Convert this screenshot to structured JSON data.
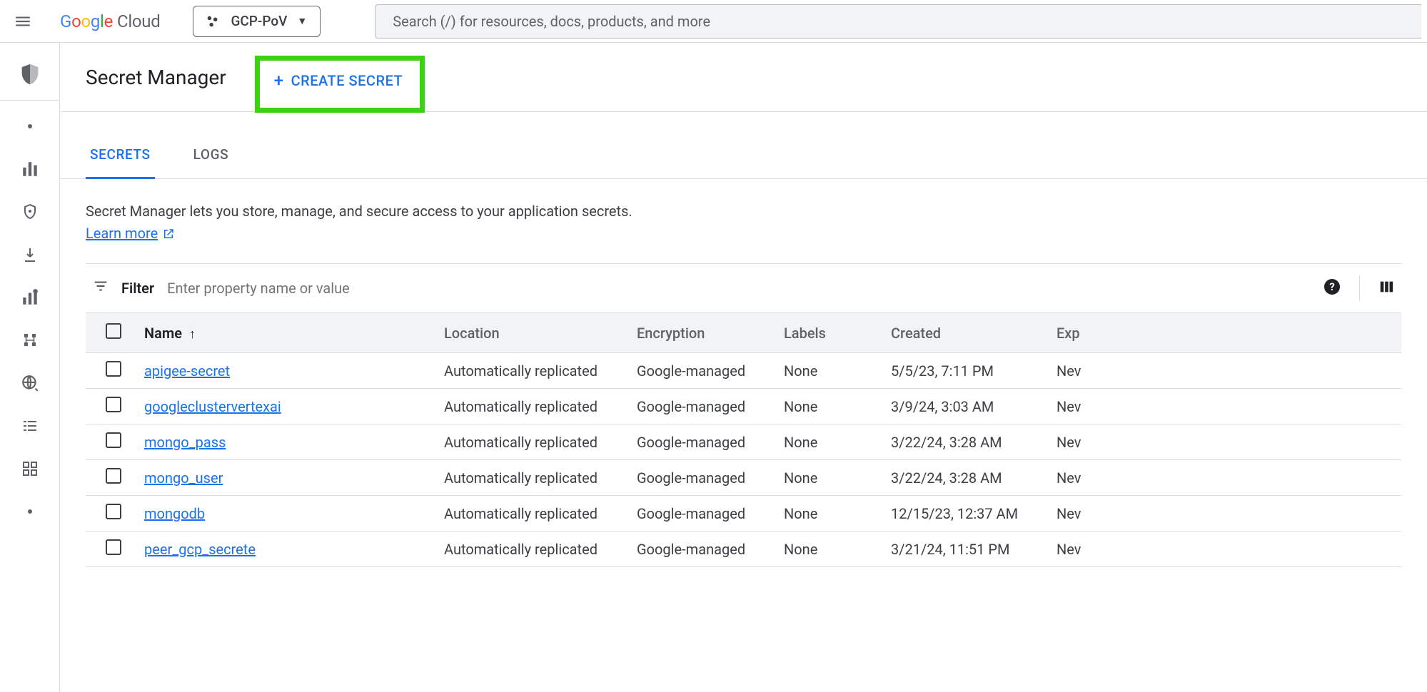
{
  "header": {
    "logo_product": "Cloud",
    "project_name": "GCP-PoV",
    "search_placeholder": "Search (/) for resources, docs, products, and more"
  },
  "page": {
    "title": "Secret Manager",
    "create_button": "CREATE SECRET"
  },
  "tabs": {
    "secrets": "SECRETS",
    "logs": "LOGS"
  },
  "intro": {
    "text": "Secret Manager lets you store, manage, and secure access to your application secrets.",
    "learn_more": "Learn more"
  },
  "filter": {
    "label": "Filter",
    "placeholder": "Enter property name or value"
  },
  "columns": {
    "name": "Name",
    "location": "Location",
    "encryption": "Encryption",
    "labels": "Labels",
    "created": "Created",
    "expiration": "Exp"
  },
  "rows": [
    {
      "name": "apigee-secret",
      "location": "Automatically replicated",
      "encryption": "Google-managed",
      "labels": "None",
      "created": "5/5/23, 7:11 PM",
      "exp": "Nev"
    },
    {
      "name": "googleclustervertexai",
      "location": "Automatically replicated",
      "encryption": "Google-managed",
      "labels": "None",
      "created": "3/9/24, 3:03 AM",
      "exp": "Nev"
    },
    {
      "name": "mongo_pass",
      "location": "Automatically replicated",
      "encryption": "Google-managed",
      "labels": "None",
      "created": "3/22/24, 3:28 AM",
      "exp": "Nev"
    },
    {
      "name": "mongo_user",
      "location": "Automatically replicated",
      "encryption": "Google-managed",
      "labels": "None",
      "created": "3/22/24, 3:28 AM",
      "exp": "Nev"
    },
    {
      "name": "mongodb",
      "location": "Automatically replicated",
      "encryption": "Google-managed",
      "labels": "None",
      "created": "12/15/23, 12:37 AM",
      "exp": "Nev"
    },
    {
      "name": "peer_gcp_secrete",
      "location": "Automatically replicated",
      "encryption": "Google-managed",
      "labels": "None",
      "created": "3/21/24, 11:51 PM",
      "exp": "Nev"
    }
  ]
}
